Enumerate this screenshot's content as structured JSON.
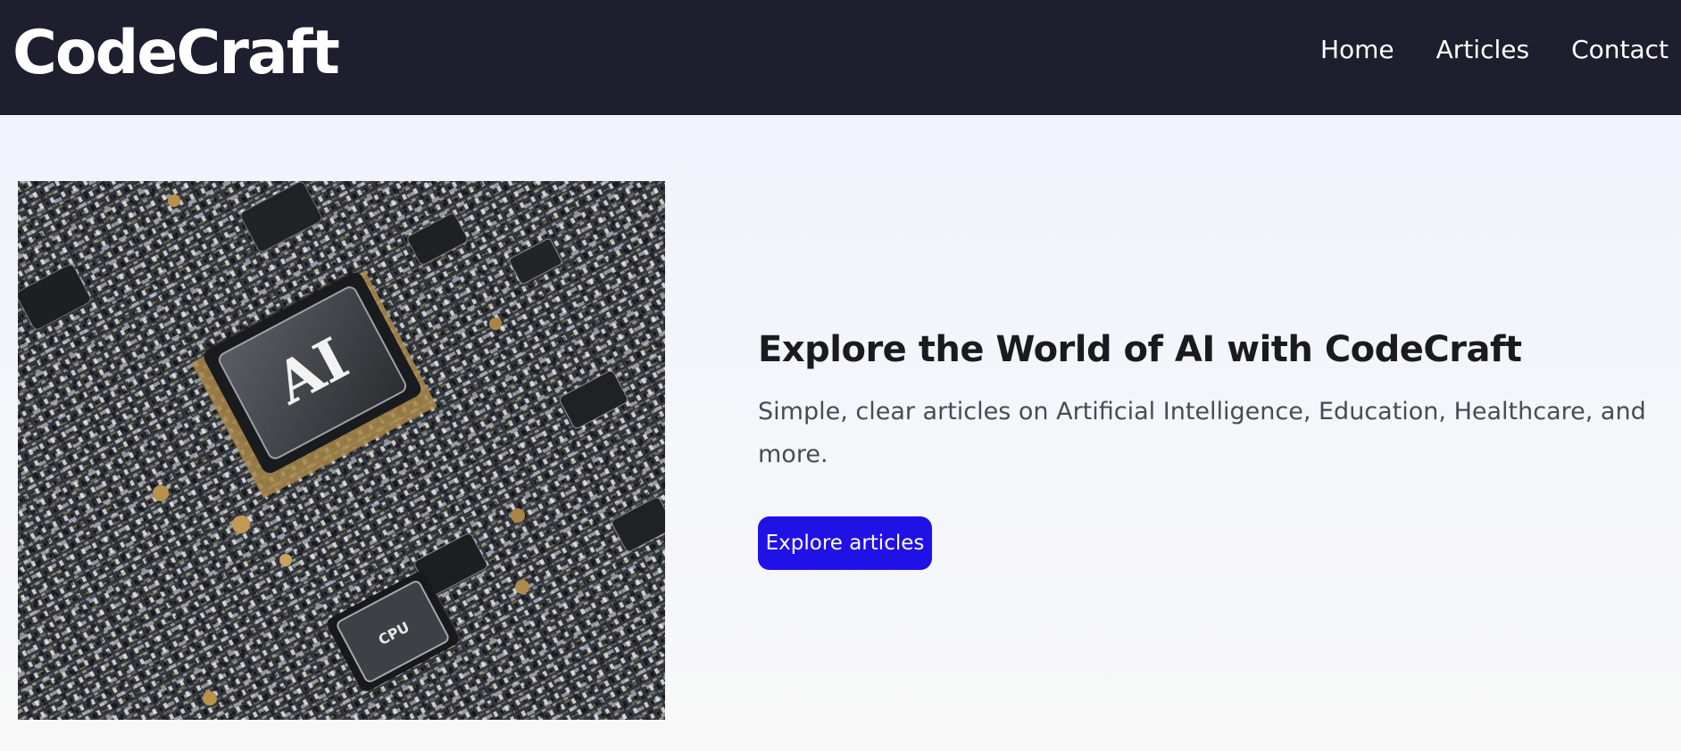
{
  "header": {
    "logo": "CodeCraft",
    "nav": [
      "Home",
      "Articles",
      "Contact"
    ]
  },
  "hero": {
    "image_chip_label": "AI",
    "image_small_chip_label": "CPU",
    "title": "Explore the World of AI with CodeCraft",
    "subtitle": "Simple, clear articles on Artificial Intelligence, Education, Healthcare, and more.",
    "cta_label": "Explore articles"
  },
  "colors": {
    "header_bg": "#1f1e2e",
    "accent": "#2012e6",
    "title": "#1b1b1f",
    "subtitle": "#4a4a50"
  }
}
